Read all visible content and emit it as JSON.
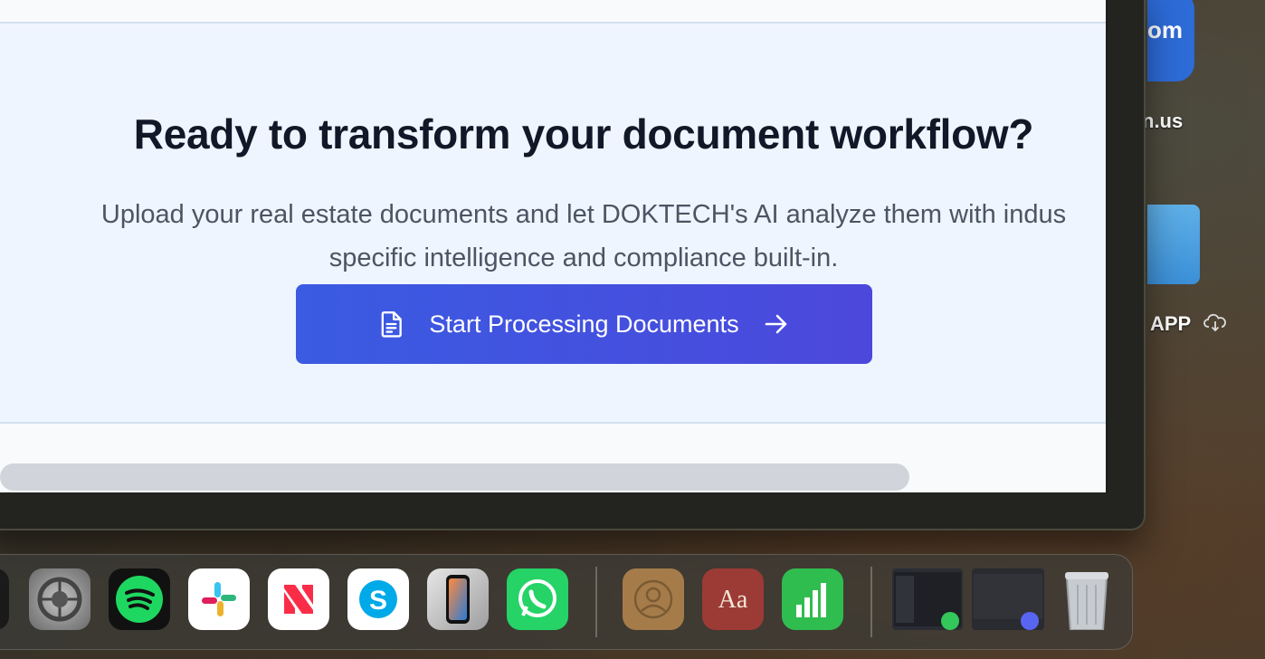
{
  "cta": {
    "heading": "Ready to transform your document workflow?",
    "description_line1": "Upload your real estate documents and let DOKTECH's AI analyze them with indus",
    "description_line2": "specific intelligence and compliance built-in.",
    "button_label": "Start Processing Documents",
    "button_icon": "document-icon",
    "button_trailing_icon": "arrow-right-icon"
  },
  "desktop": {
    "zoom_icon_text": "om",
    "zoom_label": "n.us",
    "app_label": "APP"
  },
  "dock": {
    "apps": [
      "system-settings",
      "spotify",
      "slack",
      "news",
      "skype",
      "iphone-mirroring",
      "whatsapp",
      "contacts",
      "dictionary",
      "numbers",
      "messages-window",
      "discord-window",
      "trash"
    ]
  },
  "colors": {
    "button_start": "#3a5be2",
    "button_end": "#4c48dc",
    "heading": "#111827",
    "body_text": "#4b5563",
    "cta_bg": "#eff5fe"
  }
}
